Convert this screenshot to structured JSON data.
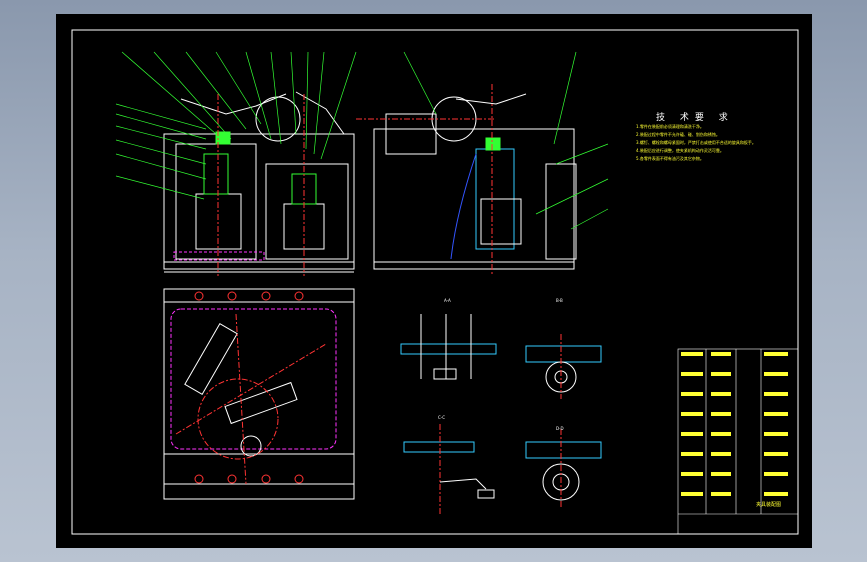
{
  "drawing": {
    "tech_requirements_title": "技 术要 求",
    "tech_requirements_lines": [
      "1.零件在装配前必须清理和清洗干净。",
      "2.装配过程中零件不允许磕、碰、划伤和锈蚀。",
      "3.螺钉、螺栓和螺母紧固时，严禁打击或使用不合适的旋具和扳手。",
      "4.装配后应进行调整，使夹紧机构动作灵活可靠。",
      "5.各零件表面不得有油污及其它杂物。"
    ],
    "section_labels": [
      "A-A",
      "B-B",
      "C-C",
      "D-D"
    ],
    "title_block_name": "夹具装配图"
  },
  "colors": {
    "frame": "#ffffff",
    "outline": "#ffffff",
    "leader": "#33ff33",
    "hatch": "#33ccff",
    "centerline": "#ff3333",
    "hidden": "#ff33ff",
    "text": "#ffff33",
    "part": "#33ff33"
  }
}
